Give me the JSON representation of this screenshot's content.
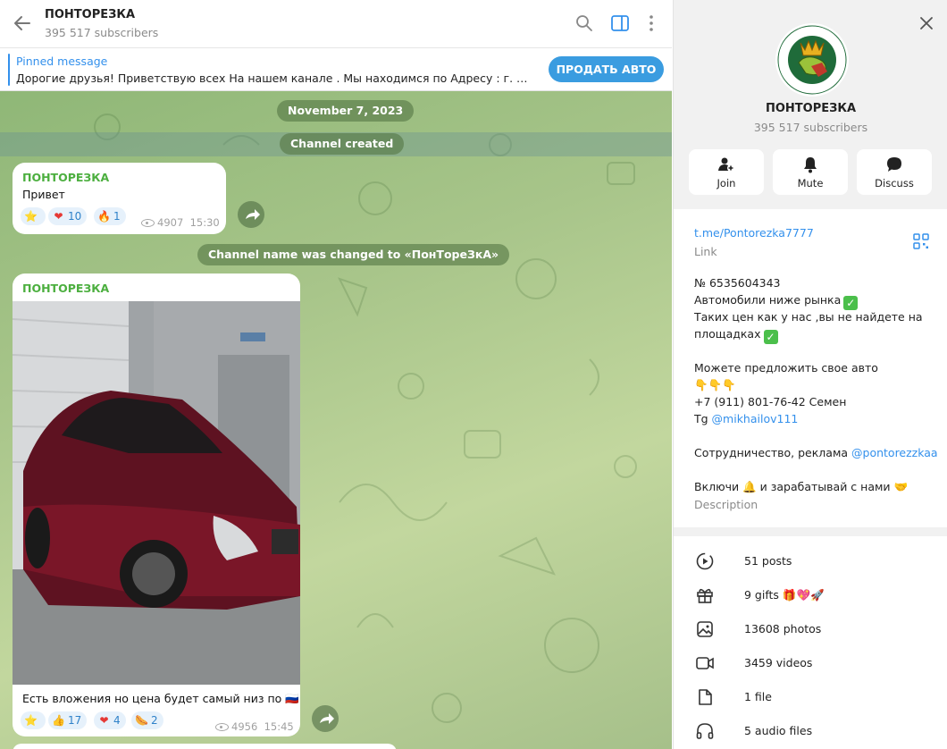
{
  "chat": {
    "title": "ПОНТОРЕЗКА",
    "subscribers": "395 517 subscribers",
    "pinned_label": "Pinned message",
    "pinned_text": "Дорогие друзья! Приветствую всех На нашем канале . Мы находимся по Адресу : г. Балаши...",
    "sell_button": "ПРОДАТЬ АВТО",
    "date_label": "November 7, 2023",
    "channel_created": "Channel created",
    "name_changed": "Channel name was changed to «ПонТореЗкА»",
    "messages": [
      {
        "author": "ПОНТОРЕЗКА",
        "text": "Привет",
        "reactions": [
          {
            "emoji": "⭐",
            "count": ""
          },
          {
            "emoji": "❤",
            "count": "10"
          },
          {
            "emoji": "🔥",
            "count": "1"
          }
        ],
        "views": "4907",
        "time": "15:30"
      },
      {
        "author": "ПОНТОРЕЗКА",
        "text": "Есть вложения но цена будет самый низ по 🇷🇺",
        "reactions": [
          {
            "emoji": "⭐",
            "count": ""
          },
          {
            "emoji": "👍",
            "count": "17"
          },
          {
            "emoji": "❤",
            "count": "4"
          },
          {
            "emoji": "🌭",
            "count": "2"
          }
        ],
        "views": "4956",
        "time": "15:45"
      }
    ]
  },
  "panel": {
    "title": "ПОНТОРЕЗКА",
    "subscribers": "395 517 subscribers",
    "logo_text": "ПОНТОРЕЗКА",
    "actions": [
      "Join",
      "Mute",
      "Discuss"
    ],
    "link": "t.me/Pontorezka7777",
    "link_label": "Link",
    "description_lines": {
      "number": "№ 6535604343",
      "line1": "Автомобили ниже рынка",
      "line2": "Таких цен как у нас ,вы не найдете  на",
      "line3": "площадках",
      "line4": "Можете предложить свое авто",
      "pointing": "👇👇👇",
      "phone": "+7 (911) 801-76-42  Семен",
      "tg_prefix": "Tg ",
      "tg_handle": "@mikhailov111",
      "coop_prefix": "Сотрудничество, реклама  ",
      "coop_handle": "@pontorezzkaa",
      "last": "Включи 🔔 и зарабатывай с нами 🤝"
    },
    "description_label": "Description",
    "stats": [
      {
        "icon": "posts-icon",
        "text": "51 posts"
      },
      {
        "icon": "gift-icon",
        "text": "9 gifts 🎁💖🚀"
      },
      {
        "icon": "photo-icon",
        "text": "13608 photos"
      },
      {
        "icon": "video-icon",
        "text": "3459 videos"
      },
      {
        "icon": "file-icon",
        "text": "1 file"
      },
      {
        "icon": "headphones-icon",
        "text": "5 audio files"
      }
    ]
  },
  "colors": {
    "accent": "#3390ec",
    "author": "#4caf3f",
    "wallpaper": "#a8c58a"
  }
}
